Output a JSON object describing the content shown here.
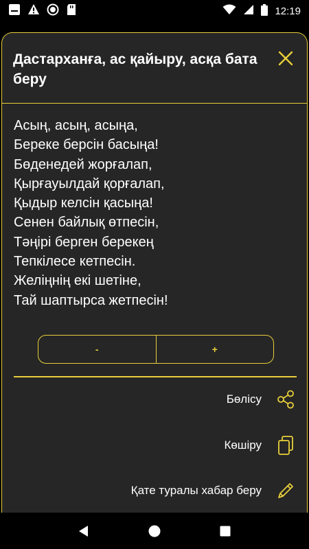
{
  "status_bar": {
    "time": "12:19",
    "icons": [
      "notification-icon",
      "warning-icon",
      "record-icon",
      "sd-card-icon",
      "wifi-icon",
      "signal-icon",
      "battery-icon"
    ]
  },
  "sheet": {
    "title": "Дастарханға, ас қайыру, асқа бата беру",
    "close_icon": "close-icon",
    "blessing_lines": [
      "Асың, асың, асыңа,",
      "Береке берсін басыңа!",
      "Бөденедей жорғалап,",
      "Қырғауылдай қорғалап,",
      "Қыдыр келсін қасыңа!",
      "Сенен байлық өтпесін,",
      "Тәңірі берген берекең",
      "Тепкілесе кетпесін.",
      "Желіңнің екі шетіне,",
      "Тай шаптырса жетпесін!"
    ],
    "zoom": {
      "minus_label": "-",
      "plus_label": "+"
    },
    "actions": {
      "share_label": "Бөлісу",
      "copy_label": "Көшіру",
      "report_label": "Қате туралы хабар беру"
    }
  },
  "colors": {
    "accent": "#e8cf3a",
    "sheet_bg": "#262626",
    "background": "#000000"
  },
  "nav_bar": {
    "icons": [
      "back-icon",
      "home-icon",
      "recents-icon"
    ]
  }
}
